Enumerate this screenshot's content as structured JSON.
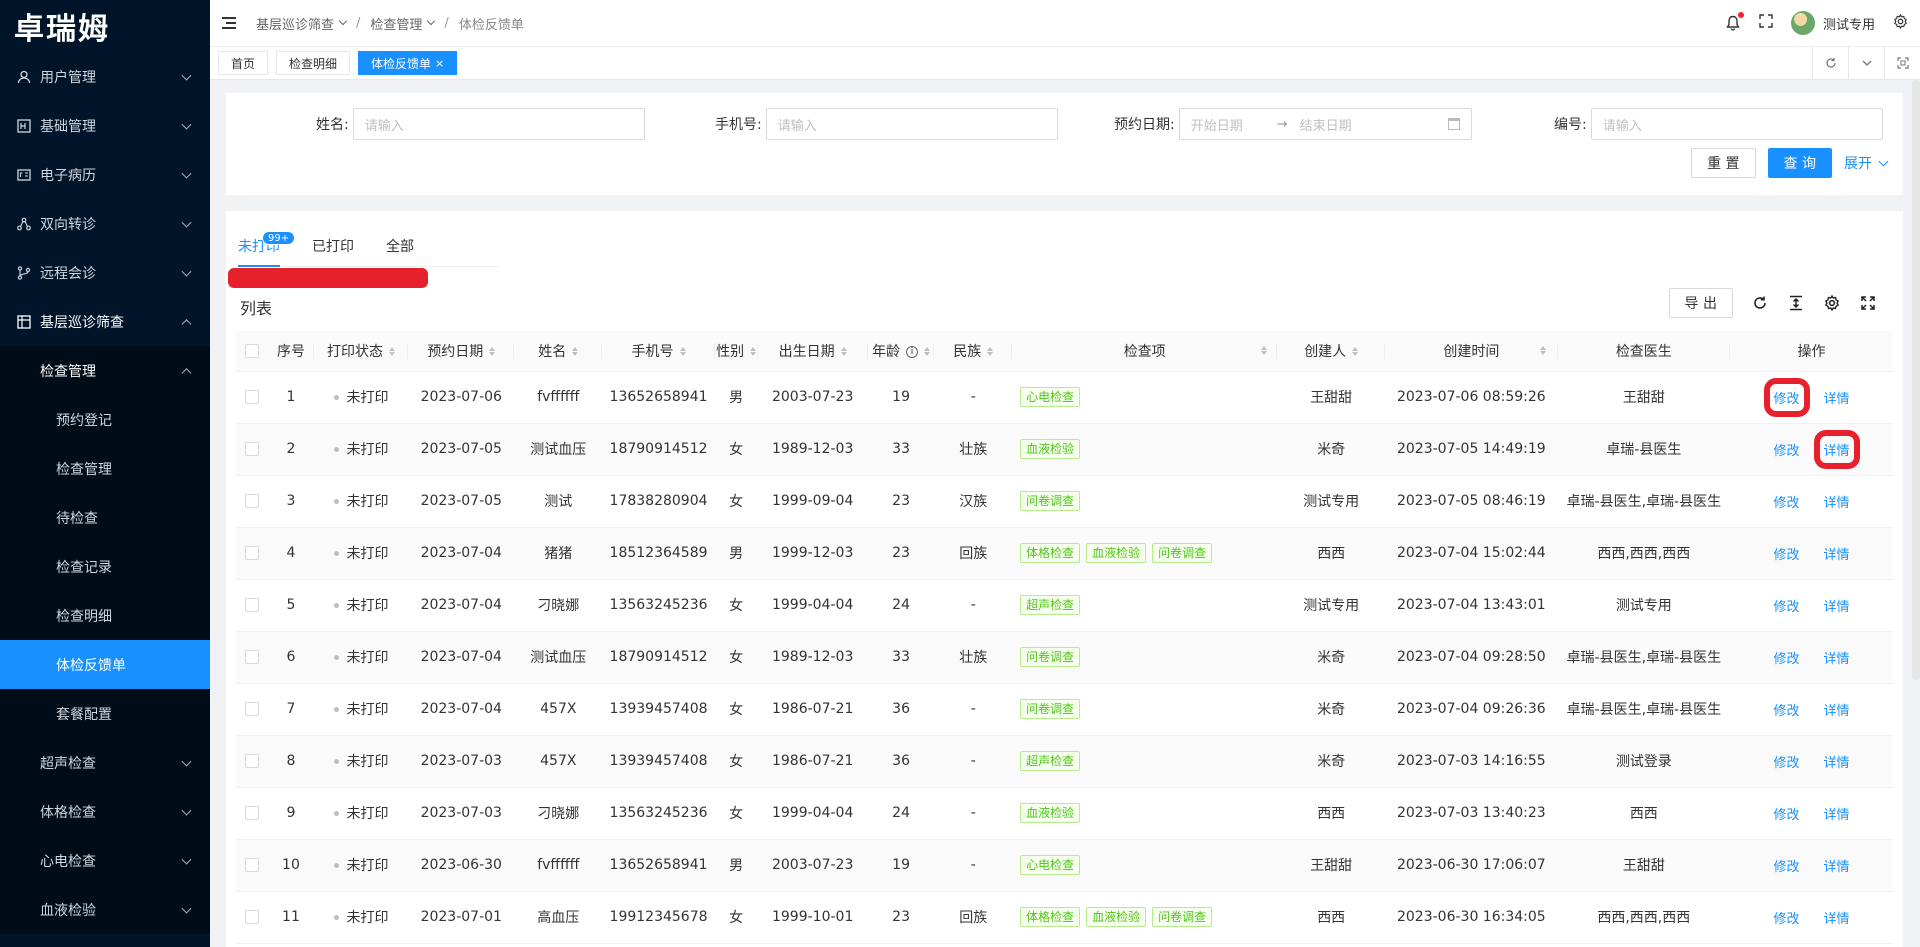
{
  "app": {
    "logo": "卓瑞姆"
  },
  "sidebar": {
    "items": [
      {
        "label": "用户管理",
        "icon": "user-icon"
      },
      {
        "label": "基础管理",
        "icon": "settings-box-icon"
      },
      {
        "label": "电子病历",
        "icon": "id-card-icon"
      },
      {
        "label": "双向转诊",
        "icon": "share-icon"
      },
      {
        "label": "远程会诊",
        "icon": "branch-icon"
      },
      {
        "label": "基层巡诊筛查",
        "icon": "grid-icon"
      }
    ],
    "submenu_label": "检查管理",
    "sub_items": [
      "预约登记",
      "检查管理",
      "待检查",
      "检查记录",
      "检查明细",
      "体检反馈单",
      "套餐配置"
    ],
    "more_items": [
      "超声检查",
      "体格检查",
      "心电检查",
      "血液检验"
    ]
  },
  "header": {
    "breadcrumbs": [
      "基层巡诊筛查",
      "检查管理",
      "体检反馈单"
    ],
    "user_name": "测试专用"
  },
  "page_tabs": [
    "首页",
    "检查明细",
    "体检反馈单"
  ],
  "search": {
    "name_label": "姓名:",
    "phone_label": "手机号:",
    "date_label": "预约日期:",
    "code_label": "编号:",
    "placeholder": "请输入",
    "start_placeholder": "开始日期",
    "end_placeholder": "结束日期",
    "reset": "重 置",
    "query": "查 询",
    "expand": "展开"
  },
  "status_tabs": {
    "unprinted": "未打印",
    "badge": "99+",
    "printed": "已打印",
    "all": "全部"
  },
  "list": {
    "title": "列表",
    "export": "导 出"
  },
  "table": {
    "columns": [
      "序号",
      "打印状态",
      "预约日期",
      "姓名",
      "手机号",
      "性别",
      "出生日期",
      "年龄",
      "民族",
      "检查项",
      "创建人",
      "创建时间",
      "检查医生",
      "操作"
    ],
    "edit": "修改",
    "detail": "详情",
    "rows": [
      {
        "no": "1",
        "status": "未打印",
        "date": "2023-07-06",
        "name": "fvffffff",
        "phone": "13652658941",
        "gender": "男",
        "birth": "2003-07-23",
        "age": "19",
        "nation": "-",
        "items": [
          "心电检查"
        ],
        "creator": "王甜甜",
        "created": "2023-07-06 08:59:26",
        "doctor": "王甜甜"
      },
      {
        "no": "2",
        "status": "未打印",
        "date": "2023-07-05",
        "name": "测试血压",
        "phone": "18790914512",
        "gender": "女",
        "birth": "1989-12-03",
        "age": "33",
        "nation": "壮族",
        "items": [
          "血液检验"
        ],
        "creator": "米奇",
        "created": "2023-07-05 14:49:19",
        "doctor": "卓瑞-县医生"
      },
      {
        "no": "3",
        "status": "未打印",
        "date": "2023-07-05",
        "name": "测试",
        "phone": "17838280904",
        "gender": "女",
        "birth": "1999-09-04",
        "age": "23",
        "nation": "汉族",
        "items": [
          "问卷调查"
        ],
        "creator": "测试专用",
        "created": "2023-07-05 08:46:19",
        "doctor": "卓瑞-县医生,卓瑞-县医生"
      },
      {
        "no": "4",
        "status": "未打印",
        "date": "2023-07-04",
        "name": "猪猪",
        "phone": "18512364589",
        "gender": "男",
        "birth": "1999-12-03",
        "age": "23",
        "nation": "回族",
        "items": [
          "体格检查",
          "血液检验",
          "问卷调查"
        ],
        "creator": "西西",
        "created": "2023-07-04 15:02:44",
        "doctor": "西西,西西,西西"
      },
      {
        "no": "5",
        "status": "未打印",
        "date": "2023-07-04",
        "name": "刁晓娜",
        "phone": "13563245236",
        "gender": "女",
        "birth": "1999-04-04",
        "age": "24",
        "nation": "-",
        "items": [
          "超声检查"
        ],
        "creator": "测试专用",
        "created": "2023-07-04 13:43:01",
        "doctor": "测试专用"
      },
      {
        "no": "6",
        "status": "未打印",
        "date": "2023-07-04",
        "name": "测试血压",
        "phone": "18790914512",
        "gender": "女",
        "birth": "1989-12-03",
        "age": "33",
        "nation": "壮族",
        "items": [
          "问卷调查"
        ],
        "creator": "米奇",
        "created": "2023-07-04 09:28:50",
        "doctor": "卓瑞-县医生,卓瑞-县医生"
      },
      {
        "no": "7",
        "status": "未打印",
        "date": "2023-07-04",
        "name": "457X",
        "phone": "13939457408",
        "gender": "女",
        "birth": "1986-07-21",
        "age": "36",
        "nation": "-",
        "items": [
          "问卷调查"
        ],
        "creator": "米奇",
        "created": "2023-07-04 09:26:36",
        "doctor": "卓瑞-县医生,卓瑞-县医生"
      },
      {
        "no": "8",
        "status": "未打印",
        "date": "2023-07-03",
        "name": "457X",
        "phone": "13939457408",
        "gender": "女",
        "birth": "1986-07-21",
        "age": "36",
        "nation": "-",
        "items": [
          "超声检查"
        ],
        "creator": "米奇",
        "created": "2023-07-03 14:16:55",
        "doctor": "测试登录"
      },
      {
        "no": "9",
        "status": "未打印",
        "date": "2023-07-03",
        "name": "刁晓娜",
        "phone": "13563245236",
        "gender": "女",
        "birth": "1999-04-04",
        "age": "24",
        "nation": "-",
        "items": [
          "血液检验"
        ],
        "creator": "西西",
        "created": "2023-07-03 13:40:23",
        "doctor": "西西"
      },
      {
        "no": "10",
        "status": "未打印",
        "date": "2023-06-30",
        "name": "fvffffff",
        "phone": "13652658941",
        "gender": "男",
        "birth": "2003-07-23",
        "age": "19",
        "nation": "-",
        "items": [
          "心电检查"
        ],
        "creator": "王甜甜",
        "created": "2023-06-30 17:06:07",
        "doctor": "王甜甜"
      },
      {
        "no": "11",
        "status": "未打印",
        "date": "2023-07-01",
        "name": "高血压",
        "phone": "19912345678",
        "gender": "女",
        "birth": "1999-10-01",
        "age": "23",
        "nation": "回族",
        "items": [
          "体格检查",
          "血液检验",
          "问卷调查"
        ],
        "creator": "西西",
        "created": "2023-06-30 16:34:05",
        "doctor": "西西,西西,西西"
      }
    ]
  },
  "colors": {
    "sidebar_bg": "#001529",
    "accent": "#1890ff",
    "highlight": "#e7212c",
    "tag_green": "#52c41a"
  }
}
